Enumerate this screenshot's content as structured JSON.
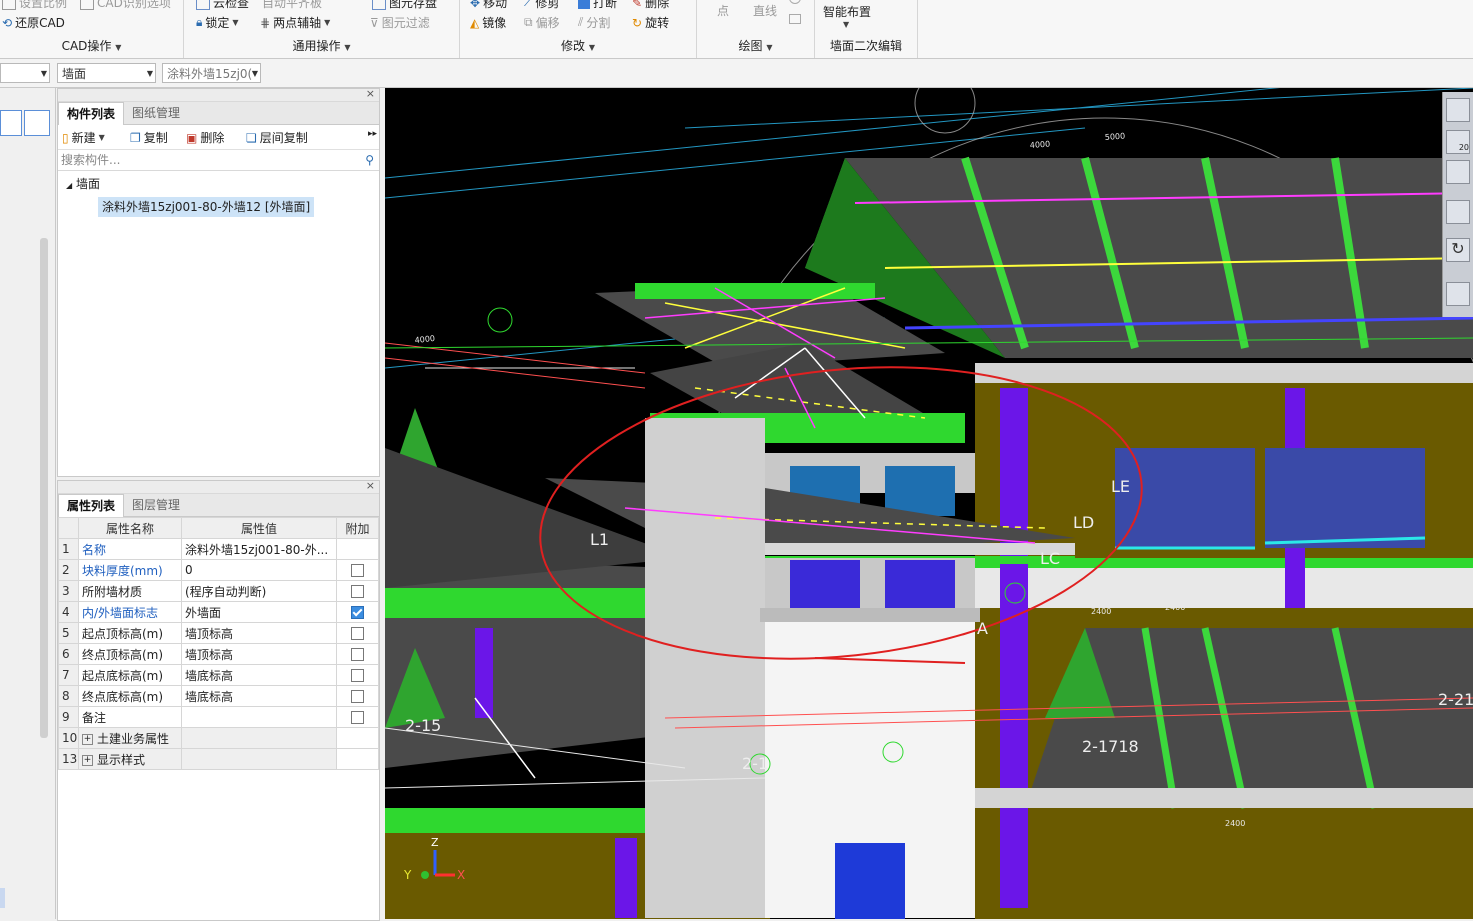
{
  "ribbon": {
    "cad_ops": {
      "top1": "设置比例",
      "top2": "CAD识别选项",
      "restore": "还原CAD",
      "label": "CAD操作"
    },
    "general_ops": {
      "top1": "云检查",
      "top2": "自动平齐板",
      "top3": "图元存盘",
      "lock": "锁定",
      "axis": "两点辅轴",
      "filter": "图元过滤",
      "label": "通用操作"
    },
    "modify": {
      "top1": "移动",
      "top2": "修剪",
      "top3": "打断",
      "top4": "删除",
      "mirror": "镜像",
      "offset": "偏移",
      "split": "分割",
      "rotate": "旋转",
      "label": "修改"
    },
    "draw": {
      "point": "点",
      "line": "直线",
      "label": "绘图"
    },
    "wall_edit": {
      "smart": "智能布置",
      "label": "墙面二次编辑"
    }
  },
  "selectors": {
    "combo1": "",
    "combo2": "墙面",
    "combo3": "涂料外墙15zj0("
  },
  "component_panel": {
    "tabs": [
      "构件列表",
      "图纸管理"
    ],
    "toolbar": {
      "new": "新建",
      "copy": "复制",
      "delete": "删除",
      "layer_copy": "层间复制"
    },
    "search_placeholder": "搜索构件...",
    "tree_root": "墙面",
    "tree_item": "涂料外墙15zj001-80-外墙12 [外墙面]"
  },
  "property_panel": {
    "tabs": [
      "属性列表",
      "图层管理"
    ],
    "headers": [
      "属性名称",
      "属性值",
      "附加"
    ],
    "rows": [
      {
        "idx": "1",
        "name": "名称",
        "value": "涂料外墙15zj001-80-外...",
        "blue": true,
        "check": null
      },
      {
        "idx": "2",
        "name": "块料厚度(mm)",
        "value": "0",
        "blue": true,
        "check": false
      },
      {
        "idx": "3",
        "name": "所附墙材质",
        "value": "(程序自动判断)",
        "blue": false,
        "check": false
      },
      {
        "idx": "4",
        "name": "内/外墙面标志",
        "value": "外墙面",
        "blue": true,
        "check": true
      },
      {
        "idx": "5",
        "name": "起点顶标高(m)",
        "value": "墙顶标高",
        "blue": false,
        "check": false
      },
      {
        "idx": "6",
        "name": "终点顶标高(m)",
        "value": "墙顶标高",
        "blue": false,
        "check": false
      },
      {
        "idx": "7",
        "name": "起点底标高(m)",
        "value": "墙底标高",
        "blue": false,
        "check": false
      },
      {
        "idx": "8",
        "name": "终点底标高(m)",
        "value": "墙底标高",
        "blue": false,
        "check": false
      },
      {
        "idx": "9",
        "name": "备注",
        "value": "",
        "blue": false,
        "check": false
      },
      {
        "idx": "10",
        "name": "土建业务属性",
        "value": "",
        "blue": false,
        "check": null,
        "expand": true
      },
      {
        "idx": "13",
        "name": "显示样式",
        "value": "",
        "blue": false,
        "check": null,
        "expand": true
      }
    ]
  },
  "viewport": {
    "labels": [
      "LE",
      "LD",
      "LC",
      "L1",
      "A",
      "2-15",
      "2-1",
      "2-1718",
      "2-21"
    ],
    "dims": [
      "4000",
      "5000",
      "4000",
      "2400",
      "2400",
      "2400",
      "2400",
      "2400",
      "2400"
    ],
    "axis": {
      "z": "Z",
      "y": "Y",
      "x": "X"
    },
    "view_badge": "20"
  }
}
